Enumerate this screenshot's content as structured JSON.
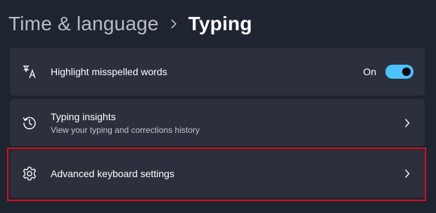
{
  "breadcrumb": {
    "parent": "Time & language",
    "current": "Typing"
  },
  "settings": [
    {
      "icon": "spellcheck-icon",
      "title": "Highlight misspelled words",
      "toggle_state_label": "On",
      "toggle_on": true
    },
    {
      "icon": "history-clock-icon",
      "title": "Typing insights",
      "subtitle": "View your typing and corrections history"
    },
    {
      "icon": "gear-icon",
      "title": "Advanced keyboard settings",
      "highlighted": true
    }
  ],
  "colors": {
    "background": "#1f2431",
    "card": "#2b303c",
    "accent": "#4cc2ff",
    "highlight_border": "#d80f1c"
  }
}
